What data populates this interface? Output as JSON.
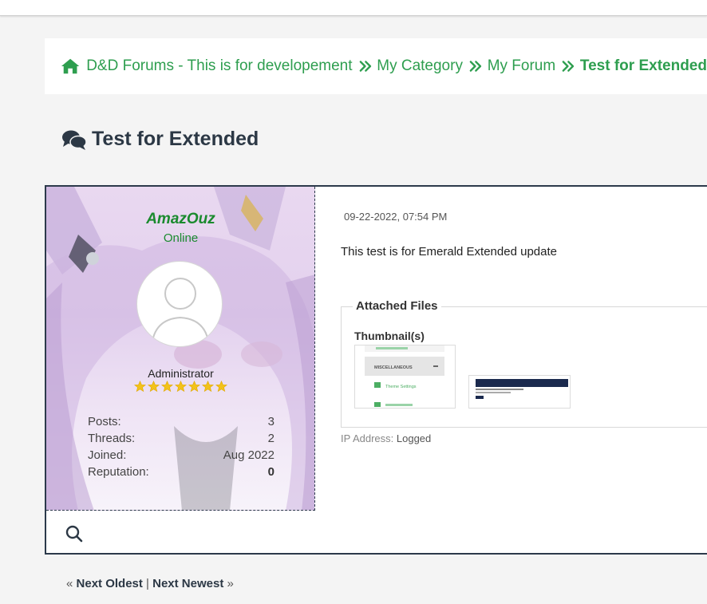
{
  "breadcrumb": {
    "items": [
      "D&D Forums - This is for developement",
      "My Category",
      "My Forum"
    ],
    "active": "Test for Extended"
  },
  "thread": {
    "title": "Test for Extended"
  },
  "author": {
    "username": "AmazOuz",
    "status": "Online",
    "role": "Administrator",
    "stars": 7,
    "stats": [
      {
        "label": "Posts:",
        "value": "3"
      },
      {
        "label": "Threads:",
        "value": "2"
      },
      {
        "label": "Joined:",
        "value": "Aug 2022"
      },
      {
        "label": "Reputation:",
        "value": "0"
      }
    ]
  },
  "post": {
    "date": "09-22-2022, 07:54 PM",
    "body": "This test is for Emerald Extended update",
    "attachments_legend": "Attached Files",
    "thumbnails_label": "Thumbnail(s)",
    "thumb1_lines": [
      "MISCELLANEOUS",
      "Theme Settings"
    ],
    "ip_label": "IP Address:",
    "ip_value": "Logged"
  },
  "pager": {
    "prev": "Next Oldest",
    "next": "Next Newest",
    "left_mark": "«",
    "sep": "|",
    "right_mark": "»"
  },
  "colors": {
    "accent_green": "#2e9e4f",
    "username_green": "#1a8a2e",
    "dark_navy": "#2c3845",
    "star_yellow": "#f2c21b"
  }
}
